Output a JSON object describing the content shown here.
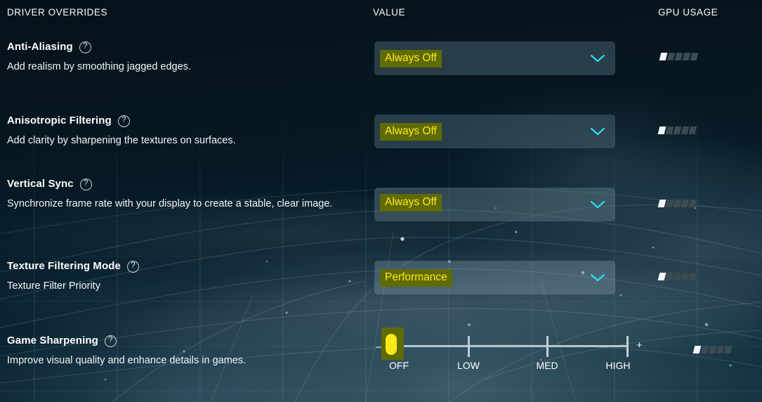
{
  "columns": {
    "driver": "DRIVER OVERRIDES",
    "value": "VALUE",
    "gpu": "GPU USAGE"
  },
  "icons": {
    "help": "?",
    "chevron": "chevron-down-icon",
    "minus": "–",
    "plus": "+"
  },
  "colors": {
    "background": "#061620",
    "accent_yellow": "#ffe81a",
    "highlight_olive": "#5f6b05",
    "chevron_cyan": "#2fd9f2",
    "gpu_on": "#f4f8fa",
    "gpu_off": "#3c4a52"
  },
  "settings": [
    {
      "title": "Anti-Aliasing",
      "description": "Add realism by smoothing jagged edges.",
      "control": "dropdown",
      "value": "Always Off",
      "gpu_filled": 1,
      "gpu_total": 5
    },
    {
      "title": "Anisotropic Filtering",
      "description": "Add clarity by sharpening the textures on surfaces.",
      "control": "dropdown",
      "value": "Always Off",
      "gpu_filled": 1,
      "gpu_total": 5
    },
    {
      "title": "Vertical Sync",
      "description": "Synchronize frame rate with your display to create a stable, clear image.",
      "control": "dropdown",
      "value": "Always Off",
      "gpu_filled": 1,
      "gpu_total": 5
    },
    {
      "title": "Texture Filtering Mode",
      "description": "Texture Filter Priority",
      "control": "dropdown",
      "value": "Performance",
      "gpu_filled": 1,
      "gpu_total": 5
    },
    {
      "title": "Game Sharpening",
      "description": "Improve visual quality and enhance details in games.",
      "control": "slider",
      "value": "OFF",
      "gpu_filled": 1,
      "gpu_total": 5
    }
  ],
  "slider": {
    "decrease_label": "–",
    "increase_label": "+",
    "current": "OFF",
    "steps": [
      {
        "label": "OFF"
      },
      {
        "label": "LOW"
      },
      {
        "label": "MED"
      },
      {
        "label": "HIGH"
      }
    ]
  }
}
